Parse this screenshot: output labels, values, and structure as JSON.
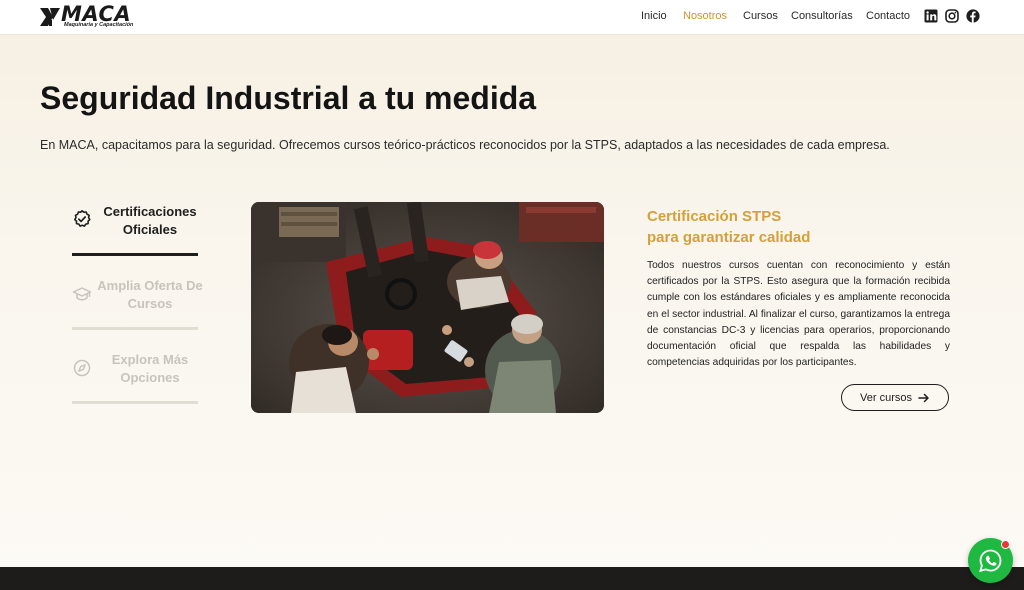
{
  "brand": {
    "logo_text": "MACA",
    "logo_subtitle": "Maquinaria y Capacitación"
  },
  "nav": {
    "items": [
      {
        "label": "Inicio",
        "active": false
      },
      {
        "label": "Nosotros",
        "active": true
      },
      {
        "label": "Cursos",
        "active": false
      },
      {
        "label": "Consultorías",
        "active": false
      },
      {
        "label": "Contacto",
        "active": false
      }
    ],
    "social_icons": [
      "linkedin-icon",
      "instagram-icon",
      "facebook-icon"
    ]
  },
  "hero": {
    "title": "Seguridad Industrial a tu medida",
    "description": "En MACA, capacitamos para la seguridad. Ofrecemos cursos teórico-prácticos reconocidos por la STPS, adaptados a las necesidades de cada empresa."
  },
  "tabs": [
    {
      "label": "Certificaciones Oficiales",
      "icon": "badge-check-icon",
      "active": true
    },
    {
      "label": "Amplia Oferta De Cursos",
      "icon": "graduation-cap-icon",
      "active": false
    },
    {
      "label": "Explora Más Opciones",
      "icon": "compass-icon",
      "active": false
    }
  ],
  "content": {
    "title_line1": "Certificación STPS",
    "title_line2": "para garantizar calidad",
    "body": "Todos nuestros cursos cuentan con reconocimiento y están certificados por la STPS. Esto asegura que la formación recibida cumple con los estándares oficiales y es ampliamente reconocida en el sector industrial. Al finalizar el curso, garantizamos la entrega de constancias DC-3 y licencias para operarios, proporcionando documentación oficial que respalda las habilidades y competencias adquiridas por los participantes.",
    "button_label": "Ver cursos"
  },
  "colors": {
    "accent": "#d4a03c",
    "nav_active": "#c9962f",
    "whatsapp": "#1fb840"
  }
}
